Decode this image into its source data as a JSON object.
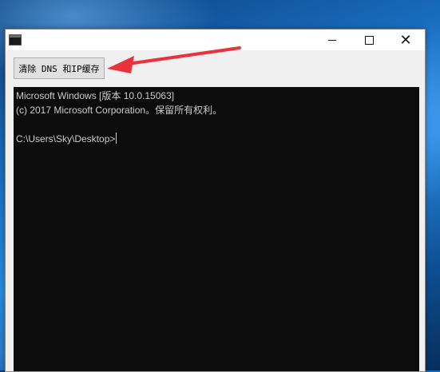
{
  "window": {
    "minimize_symbol": "",
    "maximize_symbol": "",
    "close_symbol": "✕"
  },
  "toolbar": {
    "clear_dns_ip_label": "清除 DNS 和IP缓存"
  },
  "console": {
    "lines": [
      "Microsoft Windows [版本 10.0.15063]",
      "(c) 2017 Microsoft Corporation。保留所有权利。",
      "",
      "C:\\Users\\Sky\\Desktop>"
    ]
  },
  "colors": {
    "console_bg": "#0c0c0c",
    "console_text": "#cccccc",
    "annotation_arrow": "#e8333a"
  },
  "icons": {
    "app": "console-app-icon",
    "minimize": "minimize-icon",
    "maximize": "maximize-icon",
    "close": "close-icon",
    "annotation": "red-arrow-icon"
  }
}
